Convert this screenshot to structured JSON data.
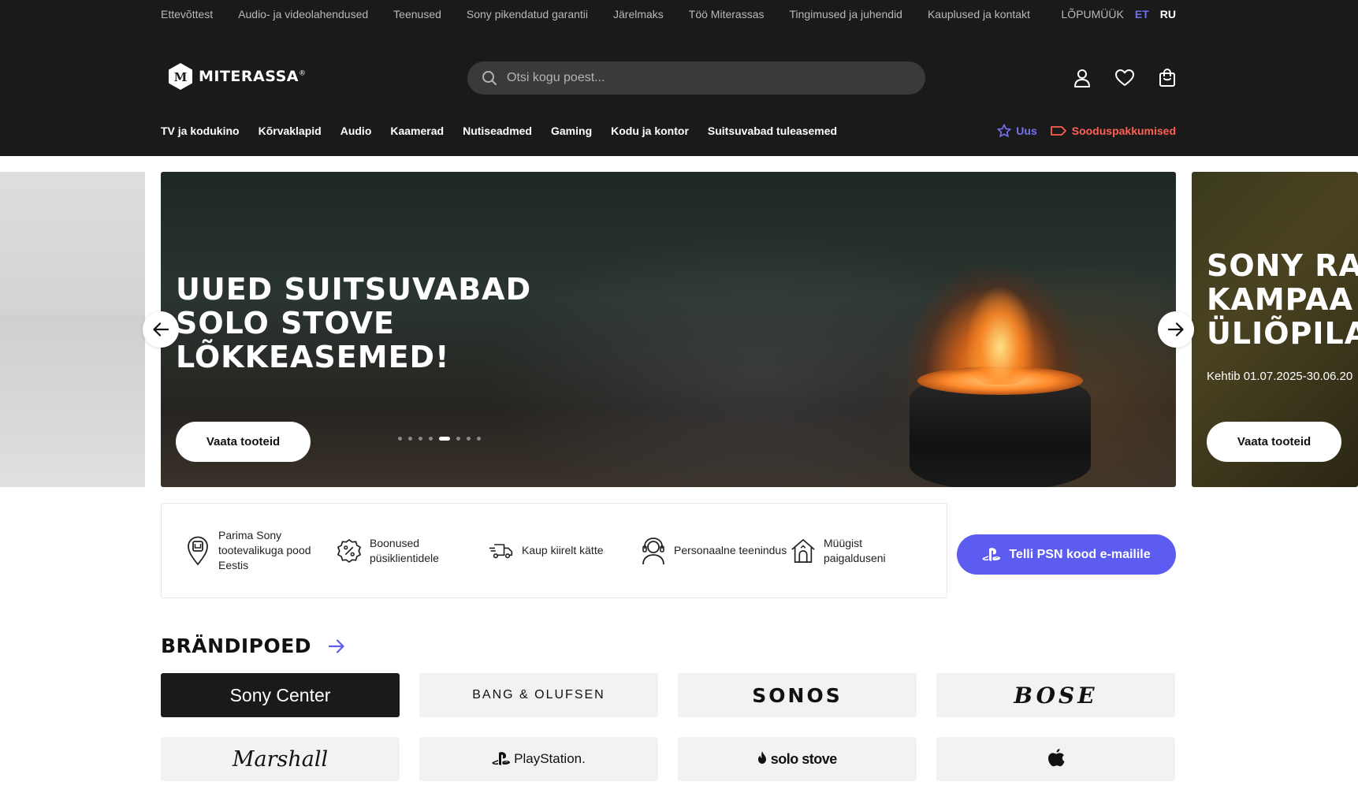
{
  "topbar": {
    "links": [
      "Ettevõttest",
      "Audio- ja videolahendused",
      "Teenused",
      "Sony pikendatud garantii",
      "Järelmaks",
      "Töö Miterassas",
      "Tingimused ja juhendid",
      "Kauplused ja kontakt"
    ],
    "closeout": "LÕPUMÜÜK",
    "lang_et": "ET",
    "lang_ru": "RU"
  },
  "logo": {
    "text": "MITERASSA",
    "mark": "M"
  },
  "search": {
    "placeholder": "Otsi kogu poest..."
  },
  "icons": {
    "account": "user-icon",
    "wishlist": "heart-icon",
    "cart": "cart-icon"
  },
  "nav": {
    "items": [
      "TV ja kodukino",
      "Kõrvaklapid",
      "Audio",
      "Kaamerad",
      "Nutiseadmed",
      "Gaming",
      "Kodu ja kontor",
      "Suitsuvabad tuleasemed"
    ],
    "new_label": "Uus",
    "deals_label": "Sooduspakkumised"
  },
  "hero": {
    "title_lines": [
      "UUED SUITSUVABAD",
      "SOLO STOVE",
      "LÕKKEASEMED!"
    ],
    "button": "Vaata tooteid",
    "dot_count": 8,
    "active_dot": 4
  },
  "next_slide": {
    "title_lines": [
      "SONY RA",
      "KAMPAA",
      "ÜLIÕPILA"
    ],
    "subtitle": "Kehtib 01.07.2025-30.06.20",
    "button": "Vaata tooteid"
  },
  "usp": [
    {
      "icon": "sony-store-icon",
      "text": "Parima Sony tootevalikuga pood Eestis"
    },
    {
      "icon": "discount-badge-icon",
      "text": "Boonused püsiklientidele"
    },
    {
      "icon": "delivery-truck-icon",
      "text": "Kaup kiirelt kätte"
    },
    {
      "icon": "support-agent-icon",
      "text": "Personaalne teenindus"
    },
    {
      "icon": "home-install-icon",
      "text": "Müügist paigalduseni"
    }
  ],
  "psn_button": "Telli PSN kood e-mailile",
  "brands": {
    "heading": "BRÄNDIPOED",
    "items": [
      "Sony Center",
      "BANG & OLUFSEN",
      "SONOS",
      "BOSE",
      "Marshall",
      "PlayStation.",
      "solo stove",
      "Apple"
    ]
  },
  "colors": {
    "accent": "#5c5cf0",
    "deals": "#ff5f52",
    "header_bg": "#1a1a1a"
  }
}
